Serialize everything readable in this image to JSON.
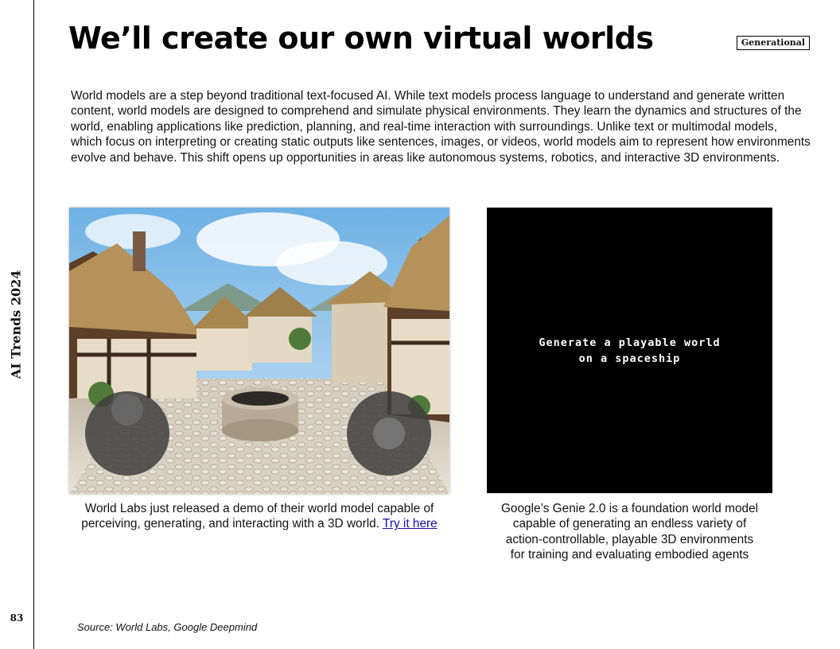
{
  "sidebar": {
    "label": "AI Trends 2024",
    "page_number": "83"
  },
  "header": {
    "title": "We’ll create our own virtual worlds",
    "tag": "Generational"
  },
  "intro": "World models are a step beyond traditional text-focused AI. While text models process language to understand and generate written content, world models are designed to comprehend and simulate physical environments. They learn the dynamics and structures of the world, enabling applications like prediction, planning, and real-time interaction with surroundings. Unlike text or multimodal models, which focus on interpreting or creating static outputs like sentences, images, or videos, world models aim to represent how environments evolve and behave. This shift opens up opportunities in areas like autonomous systems, robotics, and interactive 3D environments.",
  "left_figure": {
    "caption_line1": "World Labs just released a demo of their world model capable of",
    "caption_line2": "perceiving, generating, and interacting with a 3D world.",
    "link_text": "Try it here"
  },
  "right_figure": {
    "screen_line1": "Generate a playable world",
    "screen_line2": "on a spaceship",
    "caption_line1": "Google’s Genie 2.0 is a foundation world model",
    "caption_line2": "capable of generating an endless variety of",
    "caption_line3": "action-controllable, playable 3D environments",
    "caption_line4": "for training and evaluating embodied agents"
  },
  "footer": {
    "source": "Source: World Labs, Google Deepmind"
  },
  "colors": {
    "link": "#1a0dab",
    "sky": "#8fc3ea",
    "thatch": "#b5925a",
    "cobblestone": "#cfc6b6"
  },
  "icons": [
    "left-joystick-icon",
    "right-joystick-icon"
  ]
}
